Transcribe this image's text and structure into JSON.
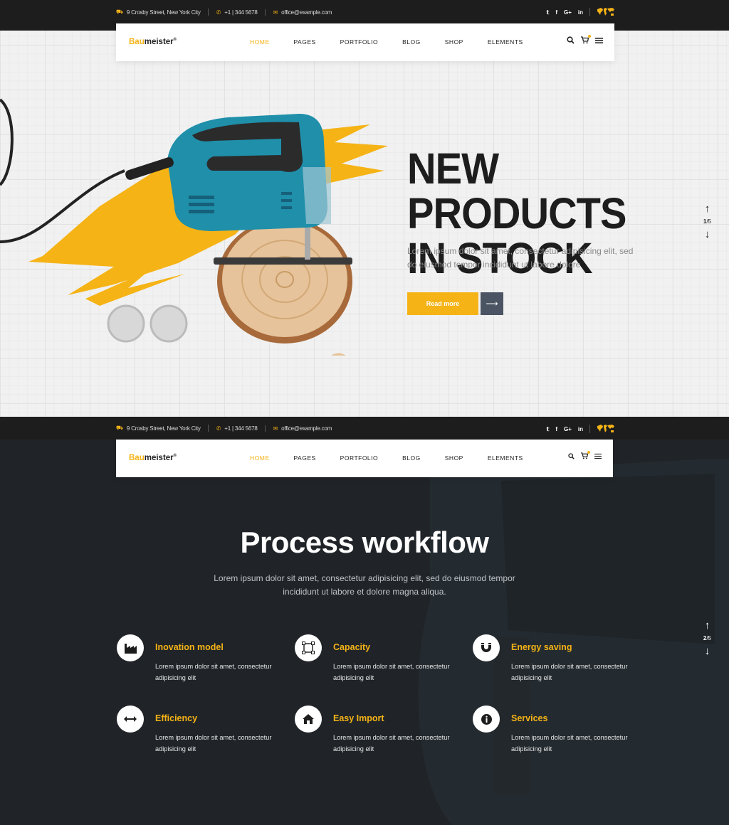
{
  "topbar": {
    "address": "9 Crosby Street, New York City",
    "phone": "+1 | 344 5678",
    "phone_alt": "+1 | 344 5678",
    "email": "office@example.com",
    "social": [
      "twitter-icon",
      "facebook-icon",
      "google-plus-icon",
      "linkedin-icon"
    ],
    "social_labels": [
      "𝕥",
      "f",
      "G+",
      "in"
    ]
  },
  "logo": {
    "brand_colored": "Bau",
    "brand_rest": "meister",
    "mark": "®"
  },
  "menu": [
    "HOME",
    "PAGES",
    "PORTFOLIO",
    "BLOG",
    "SHOP",
    "ELEMENTS"
  ],
  "hero": {
    "title_line1": "NEW PRODUCTS",
    "title_line2": "IN STOCK",
    "text": "Lorem ipsum dolor sit amet, consectetur adipisicing elit, sed do eiusmod tempor incididunt ut labore dolore",
    "button": "Read more",
    "arrow": "⟶",
    "pager_current": "1",
    "pager_total": "/5"
  },
  "process": {
    "title": "Process workflow",
    "text": "Lorem ipsum dolor sit amet, consectetur adipisicing elit, sed do eiusmod tempor incididunt ut labore et dolore magna aliqua.",
    "pager_current": "2",
    "pager_total": "/5",
    "features": [
      {
        "title": "Inovation model",
        "text": "Lorem ipsum dolor sit amet, consectetur adipisicing elit",
        "icon": "factory-icon"
      },
      {
        "title": "Capacity",
        "text": "Lorem ipsum dolor sit amet, consectetur adipisicing elit",
        "icon": "vector-icon"
      },
      {
        "title": "Energy saving",
        "text": "Lorem ipsum dolor sit amet, consectetur adipisicing elit",
        "icon": "magnet-icon"
      },
      {
        "title": "Efficiency",
        "text": "Lorem ipsum dolor sit amet, consectetur adipisicing elit",
        "icon": "arrows-horizontal-icon"
      },
      {
        "title": "Easy Import",
        "text": "Lorem ipsum dolor sit amet, consectetur adipisicing elit",
        "icon": "home-icon"
      },
      {
        "title": "Services",
        "text": "Lorem ipsum dolor sit amet, consectetur adipisicing elit",
        "icon": "info-icon"
      }
    ]
  },
  "colors": {
    "accent": "#f5b316",
    "dark": "#1d1d1d",
    "button_dark": "#4a5462",
    "section_bg": "#202428"
  }
}
